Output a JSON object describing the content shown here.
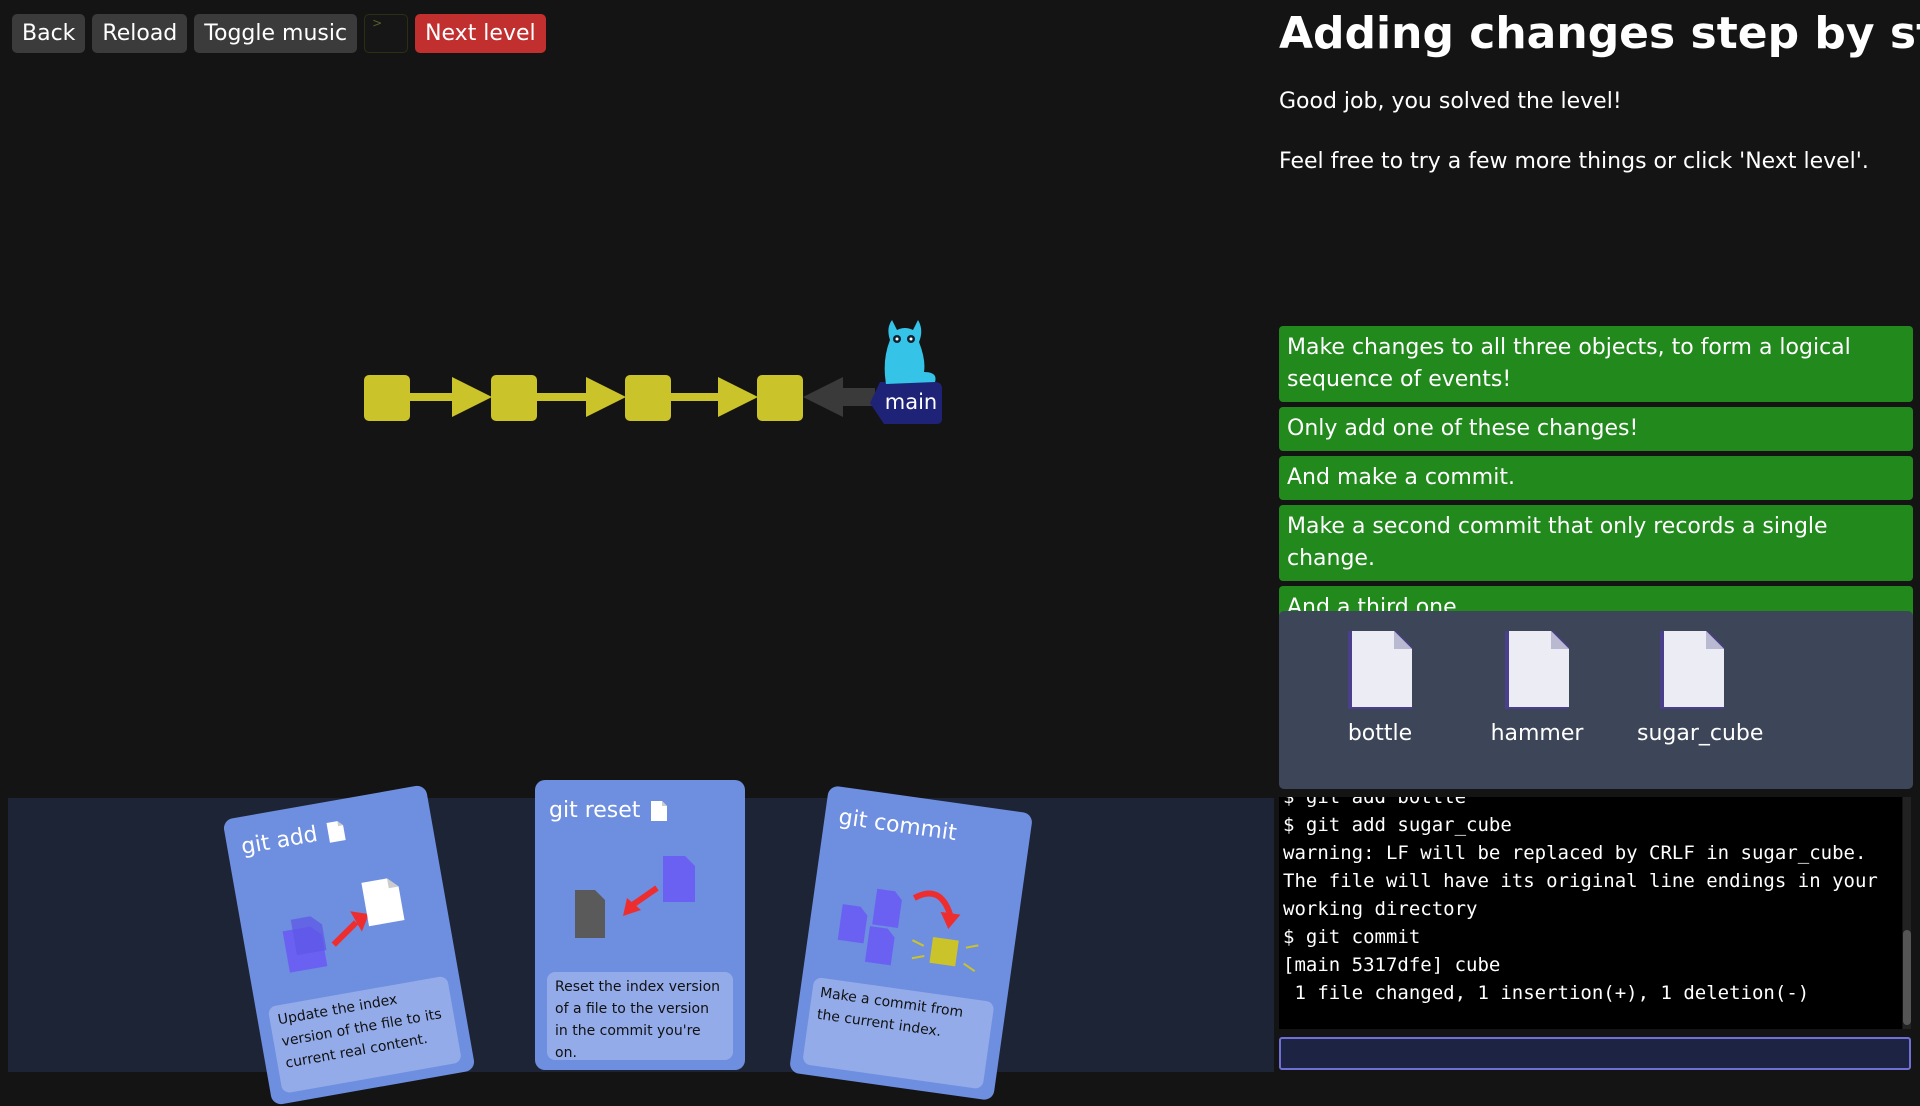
{
  "toolbar": {
    "back_label": "Back",
    "reload_label": "Reload",
    "music_label": "Toggle music",
    "terminal_glyph": ">",
    "next_label": "Next level"
  },
  "level": {
    "title": "Adding changes step by step",
    "text": [
      "Good job, you solved the level!",
      "Feel free to try a few more things or click 'Next level'."
    ]
  },
  "graph": {
    "commit_count": 4,
    "branch": "main",
    "colors": {
      "commit": "#cbc32a",
      "branch": "#1f2377",
      "mascot": "#35c3e8"
    }
  },
  "tasks": [
    "Make changes to all three objects, to form a logical sequence of events!",
    "Only add one of these changes!",
    "And make a commit.",
    "Make a second commit that only records a single change.",
    "And a third one."
  ],
  "files": [
    "bottle",
    "hammer",
    "sugar_cube"
  ],
  "terminal": {
    "lines": [
      "$ git add bottle",
      "$ git add sugar_cube",
      "warning: LF will be replaced by CRLF in sugar_cube.",
      "The file will have its original line endings in your",
      "working directory",
      "$ git commit",
      "[main 5317dfe] cube",
      " 1 file changed, 1 insertion(+), 1 deletion(-)"
    ],
    "input_value": ""
  },
  "cards": [
    {
      "title": "git add",
      "description": "Update the index version of the file to its current real content."
    },
    {
      "title": "git reset",
      "description": "Reset the index version of a file to the version in the commit you're on."
    },
    {
      "title": "git commit",
      "description": "Make a commit from the current index."
    }
  ],
  "colors": {
    "background": "#141414",
    "task_done": "#22891d",
    "next_button": "#c22f2f",
    "card": "#6e8ee0",
    "card_area": "#1d2436"
  }
}
